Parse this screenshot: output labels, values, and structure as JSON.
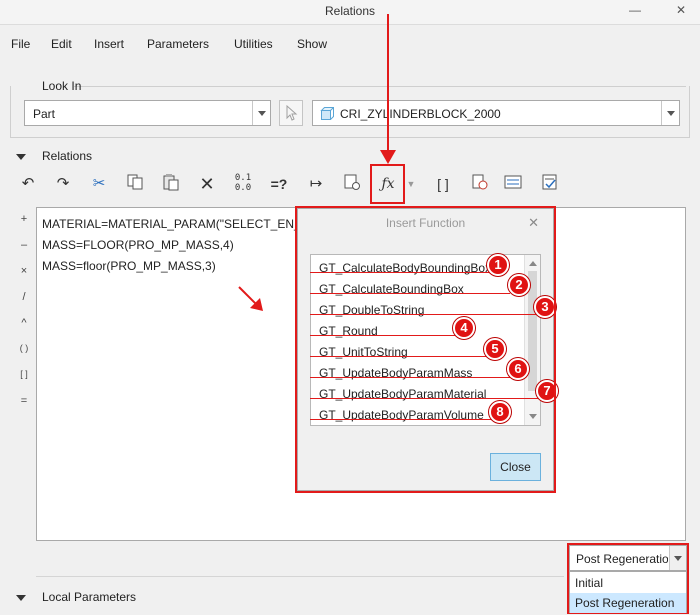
{
  "window": {
    "title": "Relations",
    "minimize_glyph": "—",
    "close_glyph": "✕"
  },
  "menu": [
    "File",
    "Edit",
    "Insert",
    "Parameters",
    "Utilities",
    "Show"
  ],
  "look_in": {
    "label": "Look In",
    "type_value": "Part",
    "model_value": "CRI_ZYLINDERBLOCK_2000"
  },
  "relations": {
    "label": "Relations"
  },
  "toolbar": {
    "icons": [
      "undo-icon",
      "redo-icon",
      "cut-icon",
      "copy-icon",
      "paste-icon",
      "delete-icon",
      "toggle-units-icon",
      "evaluate-icon",
      "dimension-icon",
      "sort-icon",
      "insert-function-icon",
      "insert-parenthesis-icon",
      "verify-icon",
      "parameter-icon",
      "relation-table-icon"
    ]
  },
  "operators": [
    "+",
    "–",
    "×",
    "/",
    "^",
    "( )",
    "[ ]",
    "="
  ],
  "editor_lines": [
    "MATERIAL=MATERIAL_PARAM(\"SELECT_EN_NAM",
    "MASS=FLOOR(PRO_MP_MASS,4)",
    "MASS=floor(PRO_MP_MASS,3)"
  ],
  "insert_function": {
    "title": "Insert Function",
    "close_label": "Close",
    "functions": [
      "GT_CalculateBodyBoundingBox",
      "GT_CalculateBoundingBox",
      "GT_DoubleToString",
      "GT_Round",
      "GT_UnitToString",
      "GT_UpdateBodyParamMass",
      "GT_UpdateBodyParamMaterial",
      "GT_UpdateBodyParamVolume"
    ],
    "badges": [
      "1",
      "2",
      "3",
      "4",
      "5",
      "6",
      "7",
      "8"
    ]
  },
  "regeneration": {
    "selected": "Post Regeneration",
    "options": [
      "Initial",
      "Post Regeneration"
    ]
  },
  "local_parameters": {
    "label": "Local Parameters"
  },
  "colors": {
    "annotation": "#e21a1a",
    "selection": "#cce8ff",
    "button_blue": "#cce7f5"
  }
}
